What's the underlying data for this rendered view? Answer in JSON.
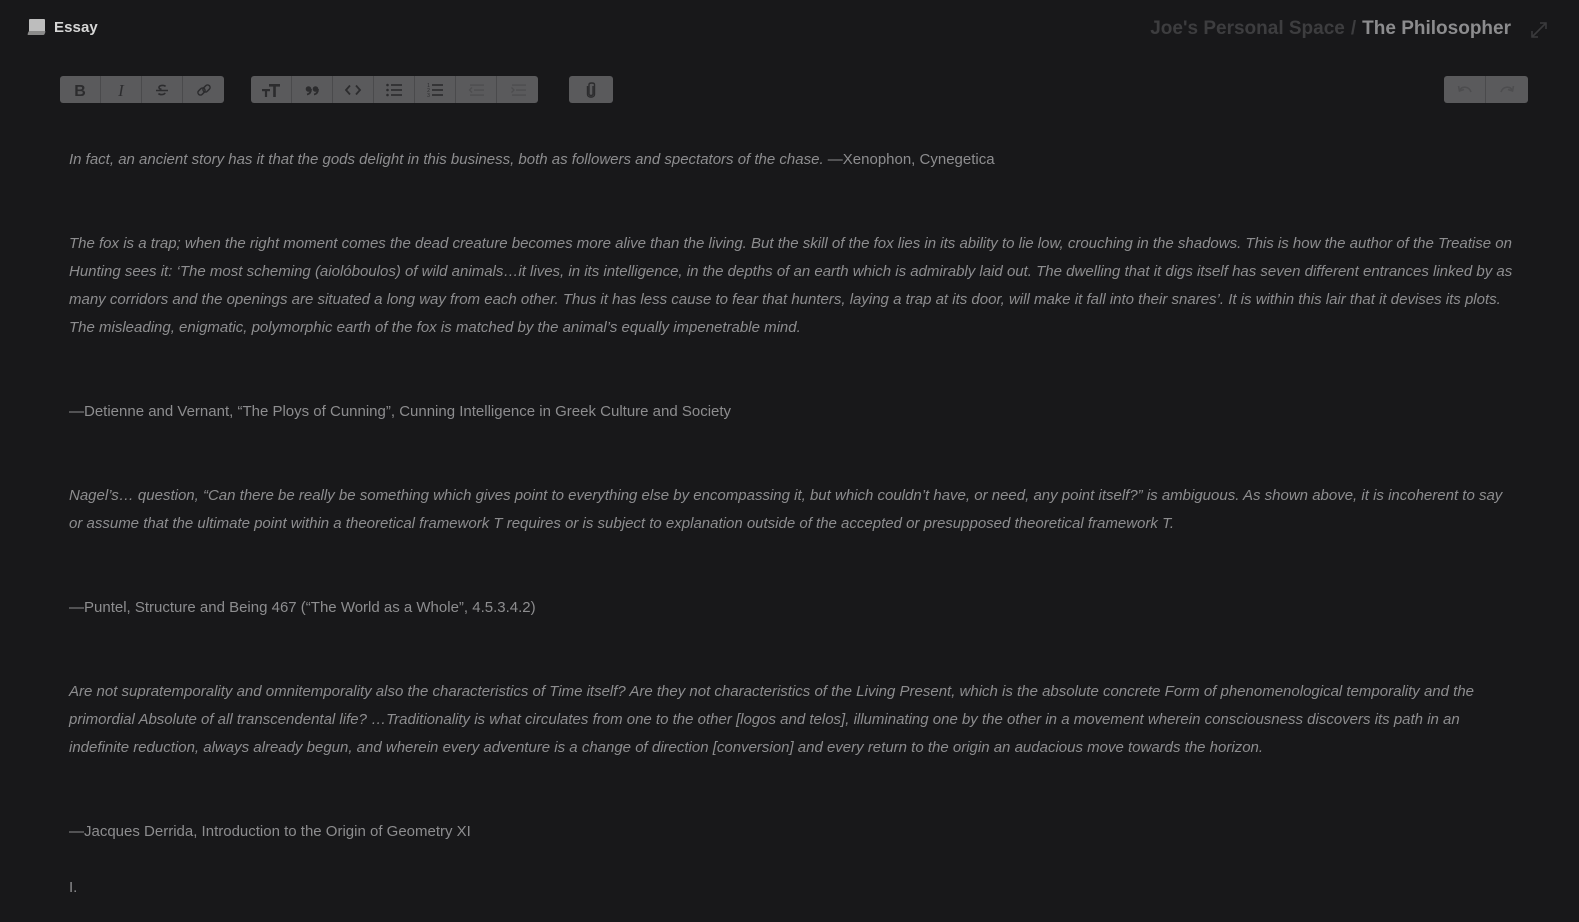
{
  "header": {
    "doc_icon": "document-icon",
    "doc_title": "Essay",
    "breadcrumb": {
      "space": "Joe's Personal Space",
      "separator": "/",
      "page": "The Philosopher"
    },
    "expand_icon": "expand-arrows-icon"
  },
  "toolbar": {
    "format_group": [
      {
        "name": "bold",
        "icon": "bold-icon"
      },
      {
        "name": "italic",
        "icon": "italic-icon"
      },
      {
        "name": "strikethrough",
        "icon": "strikethrough-icon"
      },
      {
        "name": "link",
        "icon": "link-icon"
      }
    ],
    "block_group": [
      {
        "name": "heading",
        "icon": "text-size-icon"
      },
      {
        "name": "quote",
        "icon": "quote-icon"
      },
      {
        "name": "code",
        "icon": "code-icon"
      },
      {
        "name": "bullet-list",
        "icon": "bullet-list-icon"
      },
      {
        "name": "numbered-list",
        "icon": "numbered-list-icon"
      },
      {
        "name": "outdent",
        "icon": "outdent-icon",
        "disabled": true
      },
      {
        "name": "indent",
        "icon": "indent-icon",
        "disabled": true
      }
    ],
    "attach_group": [
      {
        "name": "attach",
        "icon": "paperclip-icon"
      }
    ],
    "history_group": [
      {
        "name": "undo",
        "icon": "undo-icon",
        "disabled": true
      },
      {
        "name": "redo",
        "icon": "redo-icon",
        "disabled": true
      }
    ]
  },
  "content": {
    "paragraphs": [
      {
        "type": "mixed",
        "italic": "In fact, an ancient story has it that the gods delight in this business, both as followers and spectators of the chase. ",
        "normal": "—Xenophon, Cynegetica"
      },
      {
        "type": "quote",
        "text": "The fox is a trap; when the right moment comes the dead creature becomes more alive than the living. But the skill of the fox lies in its ability to lie low, crouching in the shadows. This is how the author of the Treatise on Hunting sees it: ‘The most scheming (aiolóboulos) of wild animals…it lives, in its intelligence, in the depths of an earth which is admirably laid out. The dwelling that it digs itself has seven different entrances linked by as many corridors and the openings are situated a long way from each other. Thus it has less cause to fear that hunters, laying a trap at its door, will make it fall into their snares’. It is within this lair that it devises its plots. The misleading, enigmatic, polymorphic earth of the fox is matched by the animal’s equally impenetrable mind."
      },
      {
        "type": "attribution",
        "text": "—Detienne and Vernant, “The Ploys of Cunning”, Cunning Intelligence in Greek Culture and Society"
      },
      {
        "type": "quote",
        "text": "Nagel’s… question, “Can there be really be something which gives point to everything else by encompassing it, but which couldn’t have, or need, any point itself?” is ambiguous. As shown above, it is incoherent to say or assume that the ultimate point within a theoretical framework T requires or is subject to explanation outside of the accepted or presupposed theoretical framework T."
      },
      {
        "type": "attribution",
        "text": "—Puntel, Structure and Being 467 (“The World as a Whole”, 4.5.3.4.2)"
      },
      {
        "type": "quote",
        "text": "Are not supratemporality and omnitemporality also the characteristics of Time itself? Are they not characteristics of the Living Present, which is the absolute concrete Form of phenomenological temporality and the primordial Absolute of all transcendental life? …Traditionality is what circulates from one to the other [logos and telos], illuminating one by the other in a movement wherein consciousness discovers its path in an indefinite reduction, always already begun, and wherein every adventure is a change of direction [conversion] and every return to the origin an audacious move towards the horizon."
      },
      {
        "type": "attribution",
        "text": "—Jacques Derrida, Introduction to the Origin of Geometry XI"
      },
      {
        "type": "heading",
        "text": "I."
      }
    ]
  }
}
